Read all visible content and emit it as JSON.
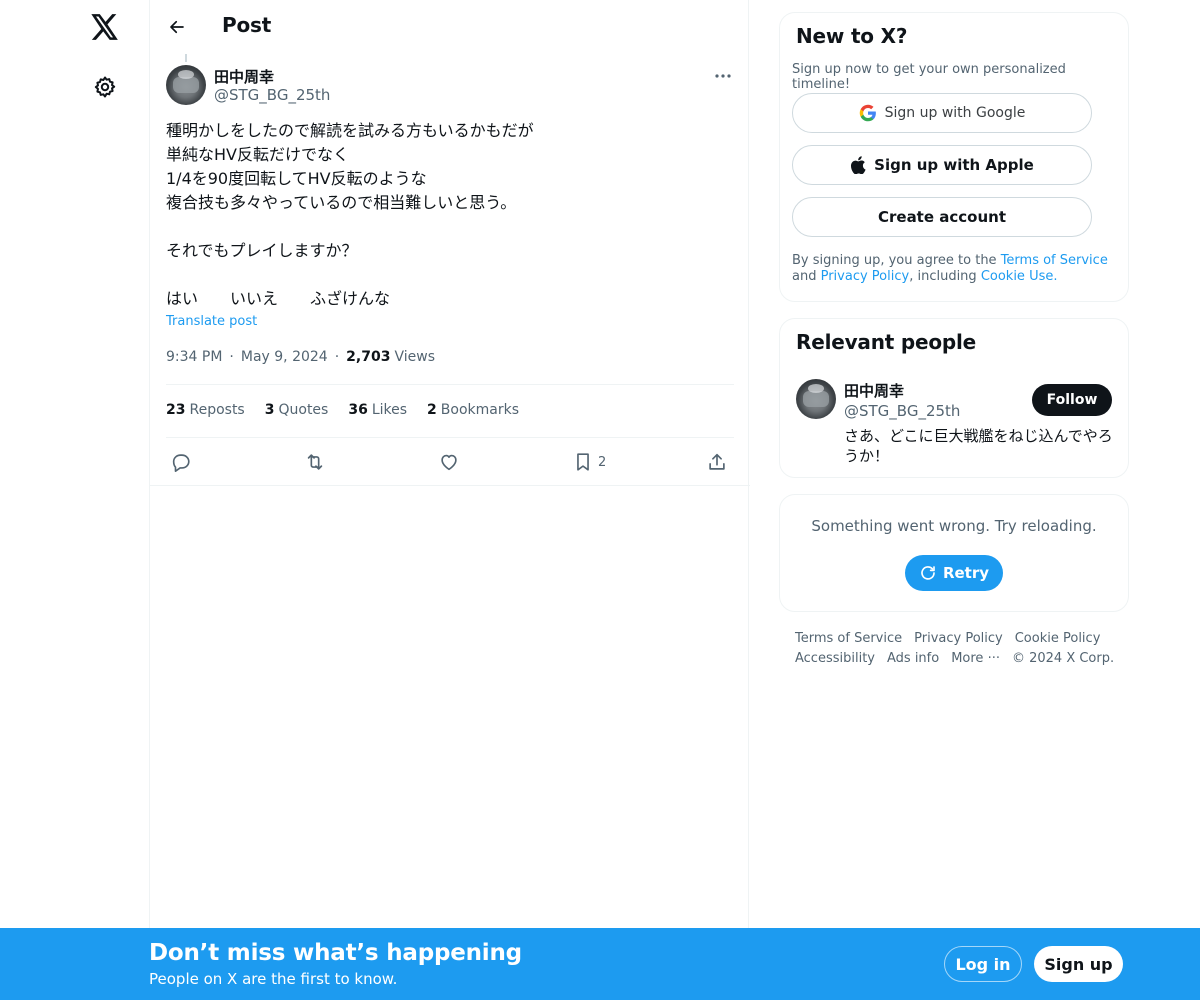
{
  "header": {
    "title": "Post"
  },
  "post": {
    "author_name": "田中周幸",
    "author_handle": "@STG_BG_25th",
    "text": "種明かしをしたので解読を試みる方もいるかもだが\n単純なHV反転だけでなく\n1/4を90度回転してHV反転のような\n複合技も多々やっているので相当難しいと思う。\n\nそれでもプレイしますか？\n\nはい　　いいえ　　ふざけんな",
    "translate_label": "Translate post",
    "time": "9:34 PM",
    "date": "May 9, 2024",
    "views_count": "2,703",
    "views_label": "Views",
    "stats": [
      {
        "count": "23",
        "label": "Reposts"
      },
      {
        "count": "3",
        "label": "Quotes"
      },
      {
        "count": "36",
        "label": "Likes"
      },
      {
        "count": "2",
        "label": "Bookmarks"
      }
    ],
    "bookmark_count": "2"
  },
  "signup_card": {
    "title": "New to X?",
    "subtitle": "Sign up now to get your own personalized timeline!",
    "google_label": "Sign up with Google",
    "apple_label": "Sign up with Apple",
    "create_label": "Create account",
    "legal_prefix": "By signing up, you agree to the ",
    "terms_link": "Terms of Service",
    "legal_and": " and ",
    "privacy_link": "Privacy Policy",
    "legal_including": ", including ",
    "cookie_link": "Cookie Use."
  },
  "relevant": {
    "title": "Relevant people",
    "name": "田中周幸",
    "handle": "@STG_BG_25th",
    "follow_label": "Follow",
    "bio": "さあ、どこに巨大戦艦をねじ込んでやろうか！"
  },
  "error_card": {
    "message": "Something went wrong. Try reloading.",
    "retry_label": "Retry"
  },
  "footer": {
    "links": [
      "Terms of Service",
      "Privacy Policy",
      "Cookie Policy",
      "Accessibility",
      "Ads info",
      "More ···"
    ],
    "copyright": "© 2024 X Corp."
  },
  "banner": {
    "title": "Don’t miss what’s happening",
    "subtitle": "People on X are the first to know.",
    "login_label": "Log in",
    "signup_label": "Sign up"
  },
  "colors": {
    "accent": "#1d9bf0",
    "text_primary": "#0f1419",
    "text_secondary": "#536471",
    "border": "#eff3f4"
  }
}
